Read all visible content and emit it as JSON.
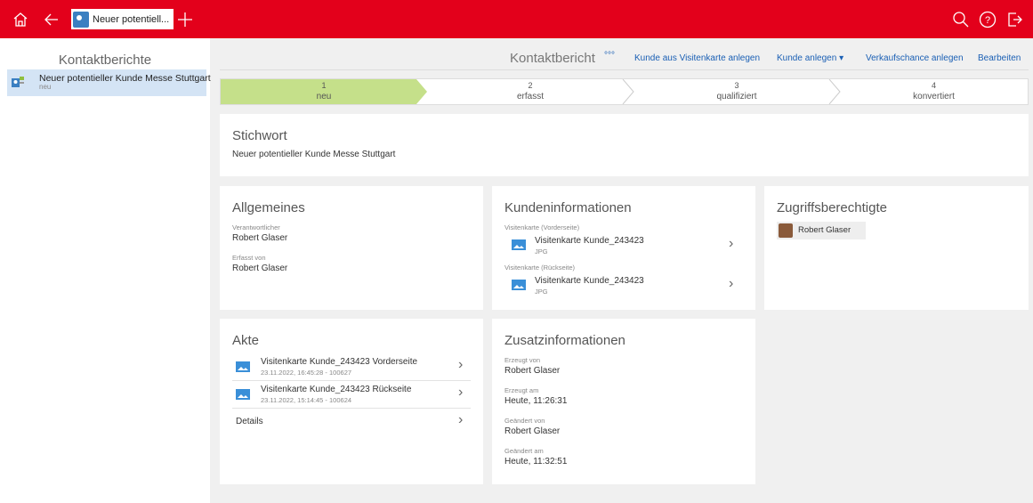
{
  "topbar": {
    "tab_label": "Neuer potentiell...",
    "icons": [
      "home-icon",
      "back-icon",
      "add-tab-icon",
      "search-icon",
      "help-icon",
      "logout-icon"
    ]
  },
  "sidebar": {
    "title": "Kontaktberichte",
    "items": [
      {
        "title": "Neuer potentieller Kunde Messe Stuttgart",
        "sub": "neu"
      }
    ]
  },
  "header": {
    "title": "Kontaktbericht",
    "more": "°°°",
    "links": [
      "Kunde aus Visitenkarte anlegen",
      "Kunde anlegen ▾",
      "Verkaufschance anlegen",
      "Bearbeiten"
    ]
  },
  "stepper": [
    {
      "n": "1",
      "label": "neu"
    },
    {
      "n": "2",
      "label": "erfasst"
    },
    {
      "n": "3",
      "label": "qualifiziert"
    },
    {
      "n": "4",
      "label": "konvertiert"
    }
  ],
  "stichwort": {
    "title": "Stichwort",
    "value": "Neuer potentieller Kunde Messe Stuttgart"
  },
  "allgemeines": {
    "title": "Allgemeines",
    "verantwortlicher_label": "Verantwortlicher",
    "verantwortlicher": "Robert Glaser",
    "erfasst_label": "Erfasst von",
    "erfasst": "Robert Glaser"
  },
  "kundeninfo": {
    "title": "Kundeninformationen",
    "front_label": "Visitenkarte (Vorderseite)",
    "front_name": "Visitenkarte Kunde_243423",
    "front_type": "JPG",
    "back_label": "Visitenkarte (Rückseite)",
    "back_name": "Visitenkarte Kunde_243423",
    "back_type": "JPG"
  },
  "zugriff": {
    "title": "Zugriffsberechtigte",
    "person": "Robert Glaser"
  },
  "akte": {
    "title": "Akte",
    "items": [
      {
        "name": "Visitenkarte Kunde_243423 Vorderseite",
        "meta": "23.11.2022, 16:45:28 - 100627"
      },
      {
        "name": "Visitenkarte Kunde_243423 Rückseite",
        "meta": "23.11.2022, 15:14:45 - 100624"
      }
    ],
    "details": "Details"
  },
  "zusatz": {
    "title": "Zusatzinformationen",
    "erzeugt_von_label": "Erzeugt von",
    "erzeugt_von": "Robert Glaser",
    "erzeugt_am_label": "Erzeugt am",
    "erzeugt_am": "Heute, 11:26:31",
    "geaendert_von_label": "Geändert von",
    "geaendert_von": "Robert Glaser",
    "geaendert_am_label": "Geändert am",
    "geaendert_am": "Heute, 11:32:51"
  },
  "colors": {
    "brand": "#e3001b",
    "active_step": "#c5e08a",
    "link": "#1a5fb4",
    "selected": "#d4e4f5"
  }
}
